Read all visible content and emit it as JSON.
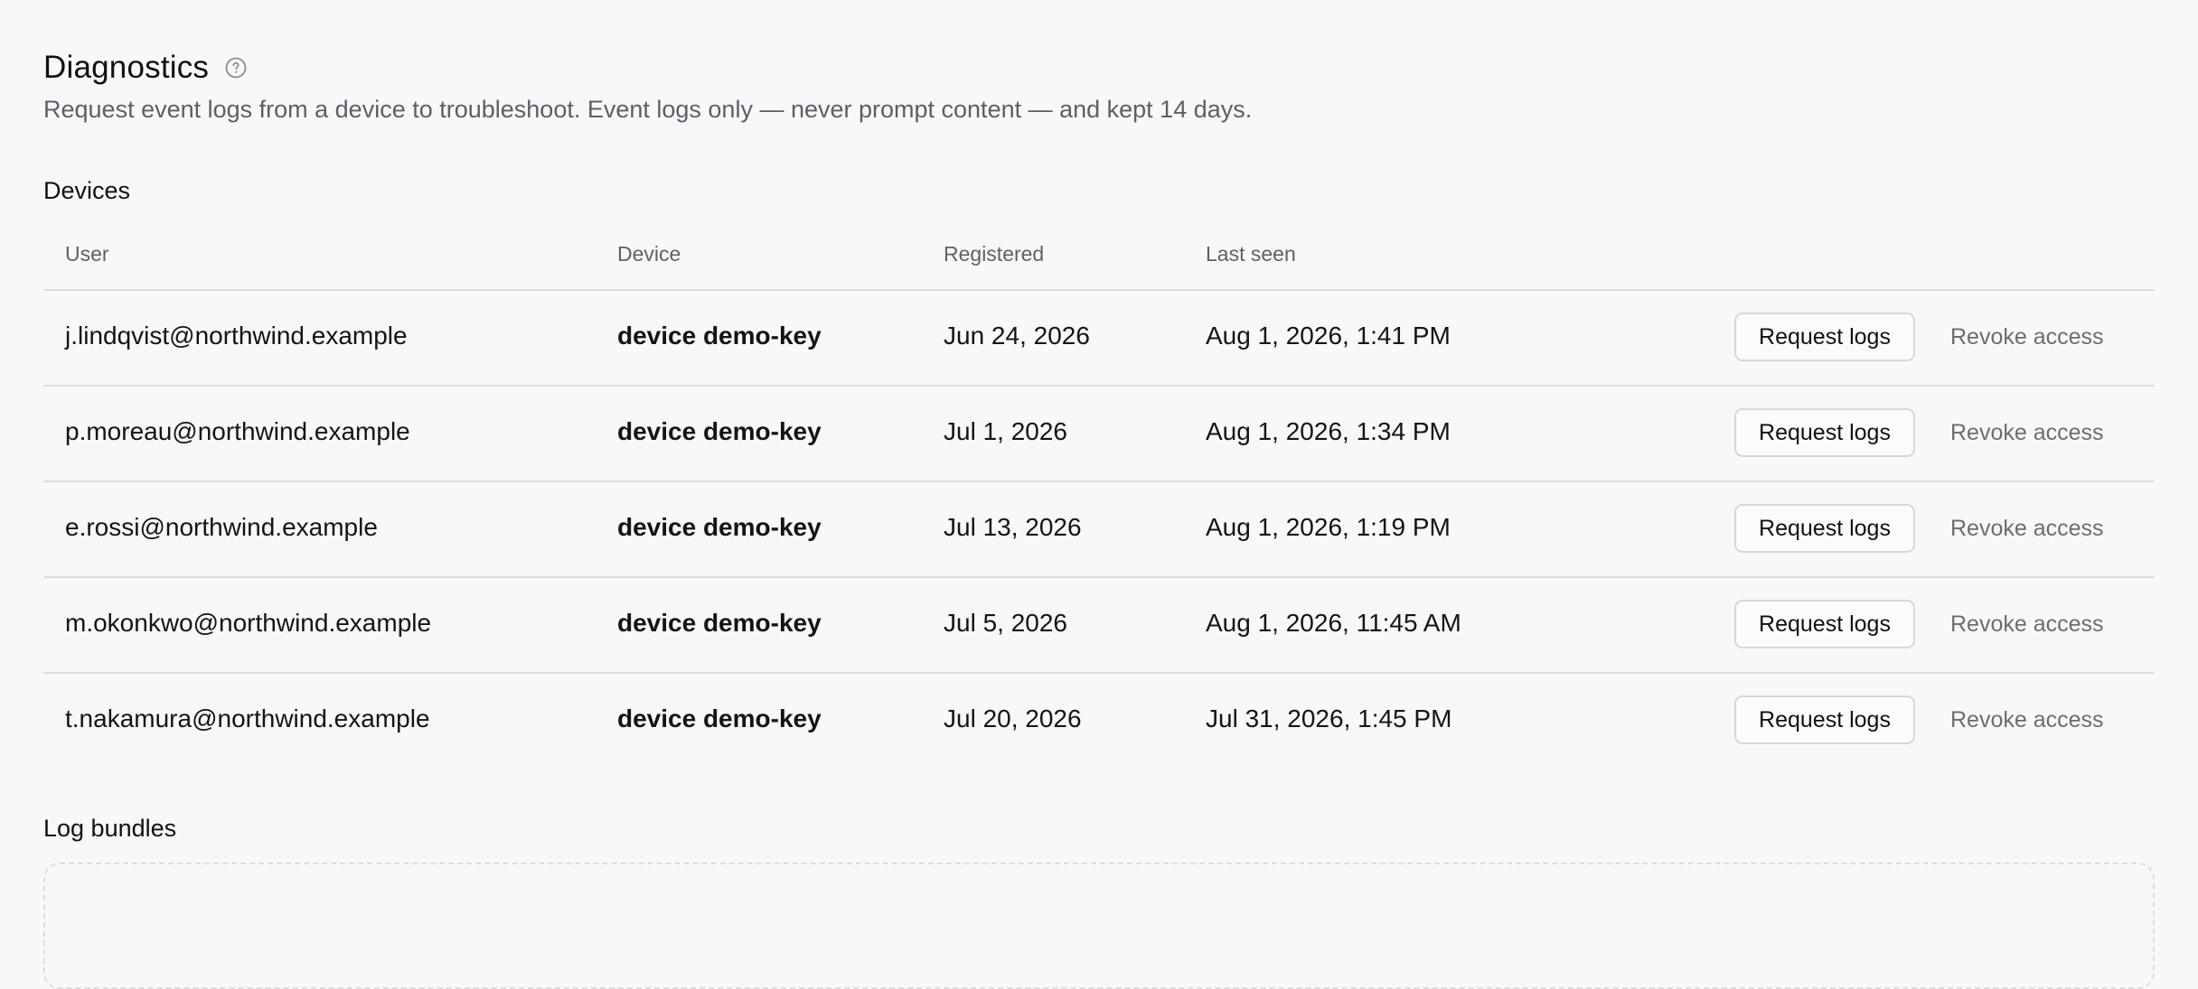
{
  "header": {
    "title": "Diagnostics",
    "help_icon": "help-circle-icon",
    "subtitle": "Request event logs from a device to troubleshoot. Event logs only — never prompt content — and kept 14 days."
  },
  "devices": {
    "title": "Devices",
    "columns": {
      "user": "User",
      "device": "Device",
      "registered": "Registered",
      "last_seen": "Last seen"
    },
    "rows": [
      {
        "user": "j.lindqvist@northwind.example",
        "device": "device demo-key",
        "registered": "Jun 24, 2026",
        "last_seen": "Aug 1, 2026, 1:41 PM",
        "request_label": "Request logs",
        "revoke_label": "Revoke access"
      },
      {
        "user": "p.moreau@northwind.example",
        "device": "device demo-key",
        "registered": "Jul 1, 2026",
        "last_seen": "Aug 1, 2026, 1:34 PM",
        "request_label": "Request logs",
        "revoke_label": "Revoke access"
      },
      {
        "user": "e.rossi@northwind.example",
        "device": "device demo-key",
        "registered": "Jul 13, 2026",
        "last_seen": "Aug 1, 2026, 1:19 PM",
        "request_label": "Request logs",
        "revoke_label": "Revoke access"
      },
      {
        "user": "m.okonkwo@northwind.example",
        "device": "device demo-key",
        "registered": "Jul 5, 2026",
        "last_seen": "Aug 1, 2026, 11:45 AM",
        "request_label": "Request logs",
        "revoke_label": "Revoke access"
      },
      {
        "user": "t.nakamura@northwind.example",
        "device": "device demo-key",
        "registered": "Jul 20, 2026",
        "last_seen": "Jul 31, 2026, 1:45 PM",
        "request_label": "Request logs",
        "revoke_label": "Revoke access"
      }
    ]
  },
  "log_bundles": {
    "title": "Log bundles"
  },
  "colors": {
    "background": "#f7f8fa",
    "text": "#111111",
    "muted_text": "#5d5f66",
    "border": "#dcdde1"
  }
}
